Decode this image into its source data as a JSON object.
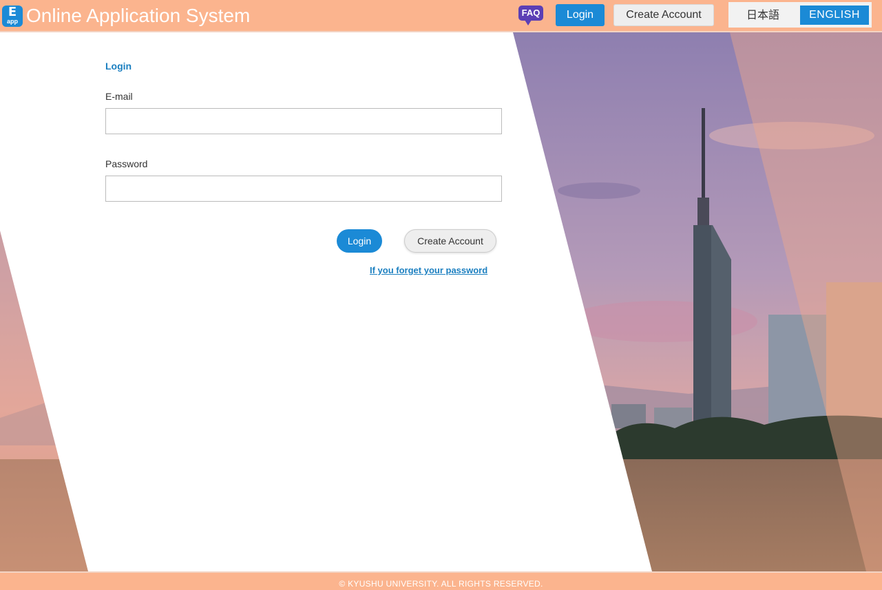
{
  "header": {
    "logo_letter": "E",
    "logo_sub": "app",
    "title": "Online Application System",
    "faq_label": "FAQ",
    "login_label": "Login",
    "create_account_label": "Create Account",
    "lang_japanese": "日本語",
    "lang_english": "ENGLISH"
  },
  "form": {
    "heading": "Login",
    "email_label": "E-mail",
    "email_value": "",
    "password_label": "Password",
    "password_value": "",
    "login_button": "Login",
    "create_account_button": "Create Account",
    "forgot_password_link": "If you forget your password"
  },
  "footer": {
    "copyright": "© KYUSHU UNIVERSITY. ALL RIGHTS RESERVED."
  },
  "colors": {
    "header_bg": "#fbb48e",
    "primary_blue": "#1b8ad6",
    "link_blue": "#1b7fc0",
    "faq_purple": "#5b3fb5"
  }
}
